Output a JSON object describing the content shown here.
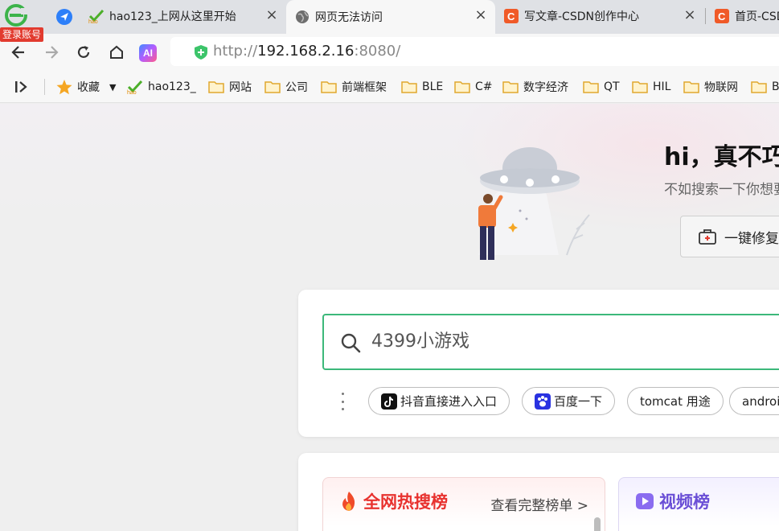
{
  "browser": {
    "login_badge": "登录账号",
    "tabs": [
      {
        "title": "hao123_上网从这里开始",
        "close": "×"
      },
      {
        "title": "网页无法访问",
        "close": "×"
      },
      {
        "title": "写文章-CSDN创作中心",
        "close": "×"
      },
      {
        "title": "首页-CSDN",
        "close": ""
      }
    ],
    "address": {
      "scheme": "http://",
      "host": "192.168.2.16",
      "port": ":8080/"
    },
    "ai_label": "AI",
    "bookmarks": [
      "收藏",
      "hao123_",
      "网站",
      "公司",
      "前端框架",
      "BLE",
      "C#",
      "数字经济",
      "QT",
      "HIL",
      "物联网",
      "B"
    ]
  },
  "page": {
    "hero_title": "hi，真不巧",
    "hero_subtitle": "不如搜索一下你想要的",
    "repair_label": "一键修复",
    "search_query": "4399小游戏",
    "suggestions": [
      "抖音直接进入入口",
      "百度一下",
      "tomcat 用途",
      "android"
    ],
    "hot_list_title": "全网热搜榜",
    "hot_list_more": "查看完整榜单 >",
    "video_list_title": "视频榜"
  },
  "colors": {
    "accent_green": "#3cb87a",
    "csdn_red": "#f05a28",
    "hot_red": "#e8322f",
    "video_purple": "#6a4fd6",
    "folder_yellow": "#f5c042"
  }
}
